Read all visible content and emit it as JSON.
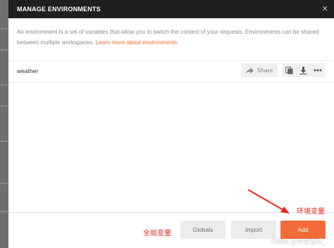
{
  "modal": {
    "title": "MANAGE ENVIRONMENTS",
    "intro_text": "An environment is a set of variables that allow you to switch the context of your requests. Environments can be shared between multiple workspaces.",
    "learn_more_link": "Learn more about environments"
  },
  "environments": [
    {
      "name": "weather",
      "share_label": "Share",
      "icons": [
        "duplicate-icon",
        "download-icon",
        "more-icon"
      ]
    }
  ],
  "footer": {
    "globals_label": "Globals",
    "import_label": "Import",
    "add_label": "Add"
  },
  "annotations": {
    "global_vars": "全局变量",
    "env_vars": "环境变量",
    "color": "#e8261e"
  },
  "watermark": "CSDN @平安喜乐_",
  "colors": {
    "header_bg": "#1f1f1f",
    "accent": "#f26b3a",
    "secondary_button": "#ececec"
  }
}
